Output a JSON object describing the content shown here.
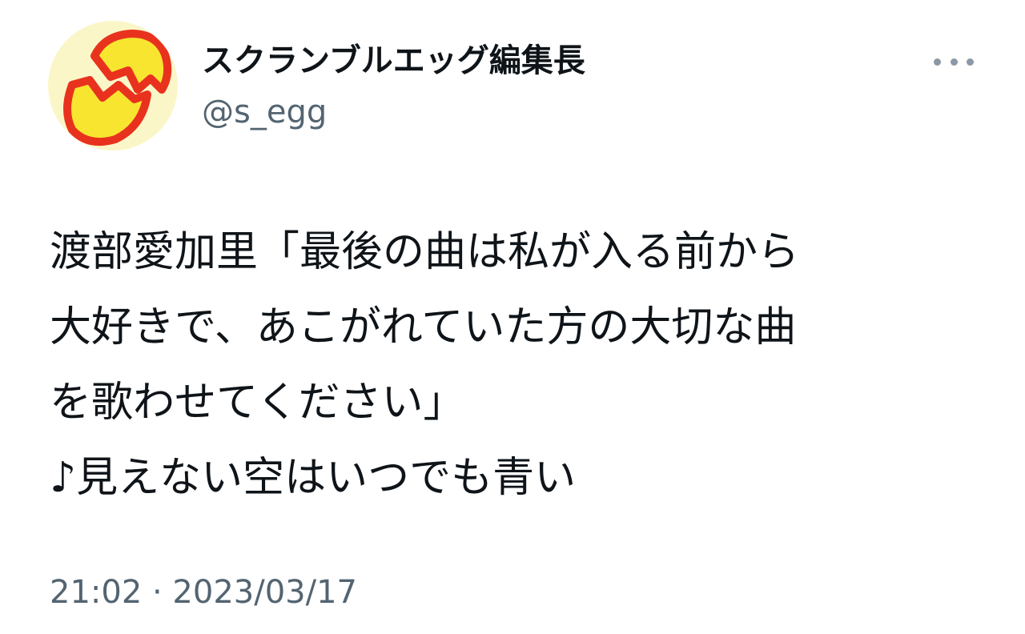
{
  "author": {
    "display_name": "スクランブルエッグ編集長",
    "handle": "@s_egg",
    "avatar_icon": "cracked-egg-logo-icon"
  },
  "menu": {
    "icon": "more-options-icon"
  },
  "tweet": {
    "lines": [
      "渡部愛加里「最後の曲は私が入る前から",
      "大好きで、あこがれていた方の大切な曲",
      "を歌わせてください」",
      "♪見えない空はいつでも青い"
    ],
    "timestamp": "21:02 · 2023/03/17"
  },
  "colors": {
    "text_primary": "#0f1419",
    "text_secondary": "#536471",
    "avatar_background": "#fbf6c7",
    "egg_red": "#e8321e",
    "egg_yellow": "#f7e530"
  }
}
